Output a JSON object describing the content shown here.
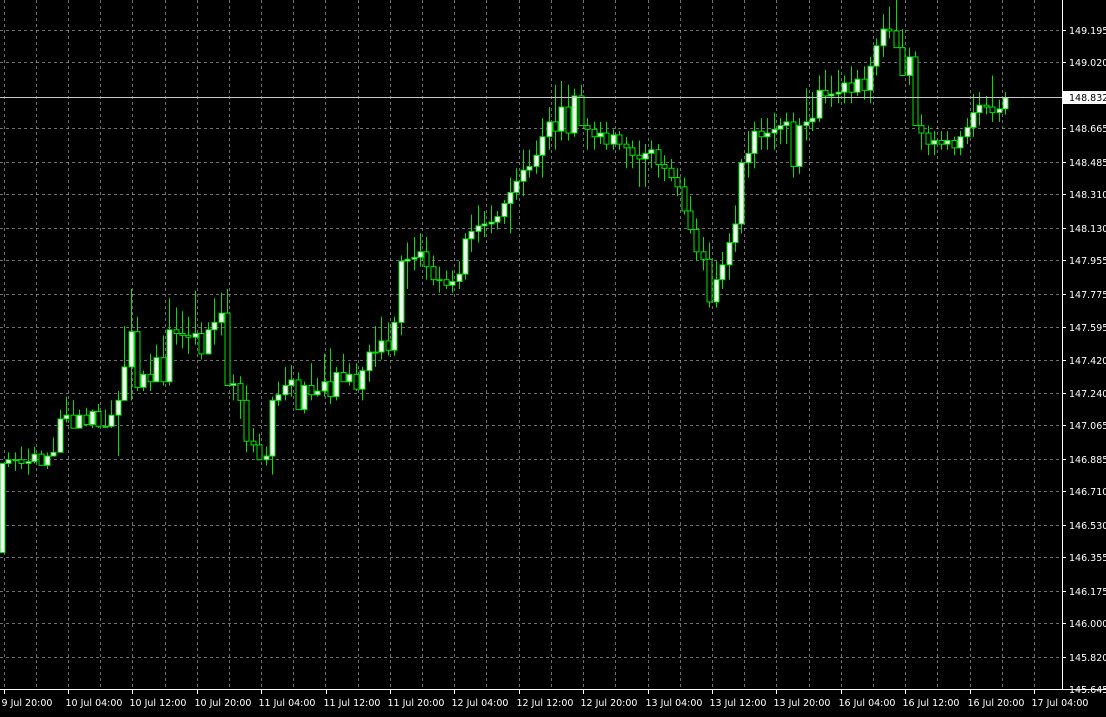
{
  "chart_data": {
    "type": "candlestick",
    "title": "",
    "xlabel": "",
    "ylabel": "",
    "ylim": [
      145.645,
      149.373
    ],
    "y_ticks": [
      149.195,
      149.02,
      148.832,
      148.665,
      148.485,
      148.31,
      148.13,
      147.955,
      147.775,
      147.595,
      147.42,
      147.24,
      147.065,
      146.885,
      146.71,
      146.53,
      146.355,
      146.175,
      146.0,
      145.82,
      145.645
    ],
    "y_tick_labels": [
      "149.195",
      "149.020",
      "148.665",
      "148.485",
      "148.310",
      "148.130",
      "147.955",
      "147.775",
      "147.595",
      "147.420",
      "147.240",
      "147.065",
      "146.885",
      "146.710",
      "146.530",
      "146.355",
      "146.175",
      "146.000",
      "145.820",
      "145.645"
    ],
    "current_price": "148.832",
    "x_labels": [
      "9 Jul 20:00",
      "10 Jul 04:00",
      "10 Jul 12:00",
      "10 Jul 20:00",
      "11 Jul 04:00",
      "11 Jul 12:00",
      "11 Jul 20:00",
      "12 Jul 04:00",
      "12 Jul 12:00",
      "12 Jul 20:00",
      "13 Jul 04:00",
      "13 Jul 12:00",
      "13 Jul 20:00",
      "16 Jul 04:00",
      "16 Jul 12:00",
      "16 Jul 20:00",
      "17 Jul 04:00"
    ],
    "grid": true,
    "bullish_color": "#f2fff2",
    "bearish_color": "#000000",
    "wick_color": "#00e000",
    "background_color": "#000000",
    "candles": [
      [
        146.38,
        146.86,
        146.38,
        146.86
      ],
      [
        146.86,
        146.92,
        146.84,
        146.88
      ],
      [
        146.88,
        146.92,
        146.82,
        146.88
      ],
      [
        146.88,
        146.95,
        146.83,
        146.86
      ],
      [
        146.86,
        146.94,
        146.8,
        146.87
      ],
      [
        146.87,
        146.95,
        146.86,
        146.91
      ],
      [
        146.91,
        146.93,
        146.85,
        146.85
      ],
      [
        146.85,
        146.92,
        146.83,
        146.9
      ],
      [
        146.9,
        147.0,
        146.9,
        146.92
      ],
      [
        146.92,
        147.15,
        146.92,
        147.1
      ],
      [
        147.1,
        147.22,
        147.08,
        147.12
      ],
      [
        147.12,
        147.2,
        147.05,
        147.05
      ],
      [
        147.05,
        147.15,
        147.05,
        147.12
      ],
      [
        147.12,
        147.16,
        147.06,
        147.07
      ],
      [
        147.07,
        147.15,
        147.05,
        147.14
      ],
      [
        147.14,
        147.18,
        147.05,
        147.06
      ],
      [
        147.06,
        147.15,
        147.05,
        147.06
      ],
      [
        147.06,
        147.2,
        147.05,
        147.12
      ],
      [
        147.12,
        147.25,
        146.9,
        147.2
      ],
      [
        147.2,
        147.6,
        147.2,
        147.38
      ],
      [
        147.38,
        147.8,
        147.2,
        147.57
      ],
      [
        147.57,
        147.65,
        147.25,
        147.27
      ],
      [
        147.27,
        147.36,
        147.25,
        147.34
      ],
      [
        147.34,
        147.45,
        147.25,
        147.3
      ],
      [
        147.3,
        147.5,
        147.3,
        147.43
      ],
      [
        147.43,
        147.55,
        147.28,
        147.3
      ],
      [
        147.3,
        147.75,
        147.28,
        147.58
      ],
      [
        147.58,
        147.7,
        147.5,
        147.56
      ],
      [
        147.56,
        147.68,
        147.48,
        147.55
      ],
      [
        147.55,
        147.65,
        147.45,
        147.54
      ],
      [
        147.54,
        147.79,
        147.5,
        147.56
      ],
      [
        147.56,
        147.62,
        147.42,
        147.45
      ],
      [
        147.45,
        147.62,
        147.45,
        147.58
      ],
      [
        147.58,
        147.75,
        147.5,
        147.62
      ],
      [
        147.62,
        147.78,
        147.55,
        147.67
      ],
      [
        147.67,
        147.8,
        147.28,
        147.28
      ],
      [
        147.28,
        147.34,
        147.2,
        147.29
      ],
      [
        147.29,
        147.33,
        147.1,
        147.2
      ],
      [
        147.2,
        147.28,
        146.92,
        146.98
      ],
      [
        146.98,
        147.05,
        146.92,
        146.96
      ],
      [
        146.96,
        147.02,
        146.88,
        146.88
      ],
      [
        146.88,
        146.95,
        146.85,
        146.9
      ],
      [
        146.9,
        147.22,
        146.8,
        147.2
      ],
      [
        147.2,
        147.3,
        147.17,
        147.23
      ],
      [
        147.23,
        147.38,
        147.2,
        147.28
      ],
      [
        147.28,
        147.39,
        147.22,
        147.31
      ],
      [
        147.31,
        147.35,
        147.15,
        147.15
      ],
      [
        147.15,
        147.3,
        147.13,
        147.28
      ],
      [
        147.28,
        147.4,
        147.2,
        147.23
      ],
      [
        147.23,
        147.32,
        147.22,
        147.25
      ],
      [
        147.25,
        147.45,
        147.22,
        147.3
      ],
      [
        147.3,
        147.48,
        147.18,
        147.22
      ],
      [
        147.22,
        147.38,
        147.2,
        147.35
      ],
      [
        147.35,
        147.45,
        147.3,
        147.3
      ],
      [
        147.3,
        147.4,
        147.28,
        147.34
      ],
      [
        147.34,
        147.4,
        147.25,
        147.26
      ],
      [
        147.26,
        147.38,
        147.2,
        147.36
      ],
      [
        147.36,
        147.5,
        147.3,
        147.46
      ],
      [
        147.46,
        147.6,
        147.38,
        147.46
      ],
      [
        147.46,
        147.65,
        147.42,
        147.52
      ],
      [
        147.52,
        147.62,
        147.44,
        147.47
      ],
      [
        147.47,
        147.65,
        147.44,
        147.62
      ],
      [
        147.62,
        147.98,
        147.55,
        147.95
      ],
      [
        147.95,
        148.05,
        147.8,
        147.96
      ],
      [
        147.96,
        148.08,
        147.9,
        147.97
      ],
      [
        147.97,
        148.1,
        147.92,
        148.0
      ],
      [
        148.0,
        148.08,
        147.85,
        147.92
      ],
      [
        147.92,
        147.98,
        147.82,
        147.85
      ],
      [
        147.85,
        147.92,
        147.78,
        147.85
      ],
      [
        147.85,
        147.9,
        147.8,
        147.82
      ],
      [
        147.82,
        147.9,
        147.78,
        147.84
      ],
      [
        147.84,
        147.95,
        147.8,
        147.88
      ],
      [
        147.88,
        148.1,
        147.85,
        148.07
      ],
      [
        148.07,
        148.2,
        148.0,
        148.11
      ],
      [
        148.11,
        148.25,
        148.05,
        148.14
      ],
      [
        148.14,
        148.22,
        148.08,
        148.15
      ],
      [
        148.15,
        148.25,
        148.1,
        148.16
      ],
      [
        148.16,
        148.22,
        148.12,
        148.19
      ],
      [
        148.19,
        148.28,
        148.15,
        148.26
      ],
      [
        148.26,
        148.4,
        148.1,
        148.32
      ],
      [
        148.32,
        148.45,
        148.28,
        148.38
      ],
      [
        148.38,
        148.55,
        148.3,
        148.44
      ],
      [
        148.44,
        148.55,
        148.4,
        148.46
      ],
      [
        148.46,
        148.6,
        148.42,
        148.52
      ],
      [
        148.52,
        148.72,
        148.4,
        148.62
      ],
      [
        148.62,
        148.78,
        148.55,
        148.7
      ],
      [
        148.7,
        148.9,
        148.55,
        148.65
      ],
      [
        148.65,
        148.92,
        148.6,
        148.78
      ],
      [
        148.78,
        148.9,
        148.6,
        148.64
      ],
      [
        148.64,
        148.88,
        148.62,
        148.84
      ],
      [
        148.84,
        148.9,
        148.68,
        148.68
      ],
      [
        148.68,
        148.72,
        148.55,
        148.66
      ],
      [
        148.66,
        148.7,
        148.55,
        148.62
      ],
      [
        148.62,
        148.7,
        148.58,
        148.64
      ],
      [
        148.64,
        148.7,
        148.55,
        148.58
      ],
      [
        148.58,
        148.66,
        148.55,
        148.63
      ],
      [
        148.63,
        148.65,
        148.55,
        148.58
      ],
      [
        148.58,
        148.62,
        148.45,
        148.56
      ],
      [
        148.56,
        148.6,
        148.45,
        148.52
      ],
      [
        148.52,
        148.6,
        148.35,
        148.5
      ],
      [
        148.5,
        148.58,
        148.35,
        148.53
      ],
      [
        148.53,
        148.6,
        148.45,
        148.55
      ],
      [
        148.55,
        148.58,
        148.4,
        148.47
      ],
      [
        148.47,
        148.52,
        148.38,
        148.45
      ],
      [
        148.45,
        148.5,
        148.38,
        148.4
      ],
      [
        148.4,
        148.45,
        148.3,
        148.35
      ],
      [
        148.35,
        148.4,
        148.2,
        148.22
      ],
      [
        148.22,
        148.3,
        148.1,
        148.12
      ],
      [
        148.12,
        148.18,
        147.95,
        148.0
      ],
      [
        148.0,
        148.08,
        147.9,
        147.96
      ],
      [
        147.96,
        148.05,
        147.7,
        147.73
      ],
      [
        147.73,
        147.95,
        147.7,
        147.85
      ],
      [
        147.85,
        148.0,
        147.8,
        147.93
      ],
      [
        147.93,
        148.1,
        147.85,
        148.05
      ],
      [
        148.05,
        148.25,
        148.0,
        148.15
      ],
      [
        148.15,
        148.5,
        148.1,
        148.48
      ],
      [
        148.48,
        148.65,
        148.4,
        148.53
      ],
      [
        148.53,
        148.7,
        148.45,
        148.65
      ],
      [
        148.65,
        148.72,
        148.55,
        148.62
      ],
      [
        148.62,
        148.72,
        148.55,
        148.64
      ],
      [
        148.64,
        148.75,
        148.55,
        148.66
      ],
      [
        148.66,
        148.72,
        148.58,
        148.68
      ],
      [
        148.68,
        148.75,
        148.58,
        148.7
      ],
      [
        148.7,
        148.75,
        148.4,
        148.46
      ],
      [
        148.46,
        148.72,
        148.42,
        148.68
      ],
      [
        148.68,
        148.88,
        148.6,
        148.7
      ],
      [
        148.7,
        148.86,
        148.65,
        148.72
      ],
      [
        148.72,
        148.95,
        148.7,
        148.87
      ],
      [
        148.87,
        148.98,
        148.8,
        148.84
      ],
      [
        148.84,
        148.95,
        148.78,
        148.85
      ],
      [
        148.85,
        148.98,
        148.8,
        148.86
      ],
      [
        148.86,
        148.95,
        148.8,
        148.91
      ],
      [
        148.91,
        149.0,
        148.8,
        148.86
      ],
      [
        148.86,
        148.98,
        148.84,
        148.93
      ],
      [
        148.93,
        149.0,
        148.82,
        148.87
      ],
      [
        148.87,
        149.05,
        148.8,
        149.0
      ],
      [
        149.0,
        149.15,
        148.95,
        149.11
      ],
      [
        149.11,
        149.28,
        149.05,
        149.2
      ],
      [
        149.2,
        149.32,
        149.15,
        149.19
      ],
      [
        149.19,
        149.37,
        149.1,
        149.1
      ],
      [
        149.1,
        149.2,
        148.95,
        148.95
      ],
      [
        148.95,
        149.1,
        148.9,
        149.05
      ],
      [
        149.05,
        149.08,
        148.68,
        148.68
      ],
      [
        148.68,
        148.74,
        148.55,
        148.64
      ],
      [
        148.64,
        148.68,
        148.52,
        148.58
      ],
      [
        148.58,
        148.65,
        148.52,
        148.6
      ],
      [
        148.6,
        148.65,
        148.55,
        148.58
      ],
      [
        148.58,
        148.65,
        148.55,
        148.6
      ],
      [
        148.6,
        148.62,
        148.52,
        148.56
      ],
      [
        148.56,
        148.65,
        148.52,
        148.62
      ],
      [
        148.62,
        148.72,
        148.58,
        148.67
      ],
      [
        148.67,
        148.85,
        148.62,
        148.75
      ],
      [
        148.75,
        148.86,
        148.68,
        148.79
      ],
      [
        148.79,
        148.84,
        148.74,
        148.78
      ],
      [
        148.78,
        148.95,
        148.7,
        148.75
      ],
      [
        148.75,
        148.82,
        148.7,
        148.77
      ],
      [
        148.77,
        148.86,
        148.74,
        148.83
      ]
    ]
  }
}
